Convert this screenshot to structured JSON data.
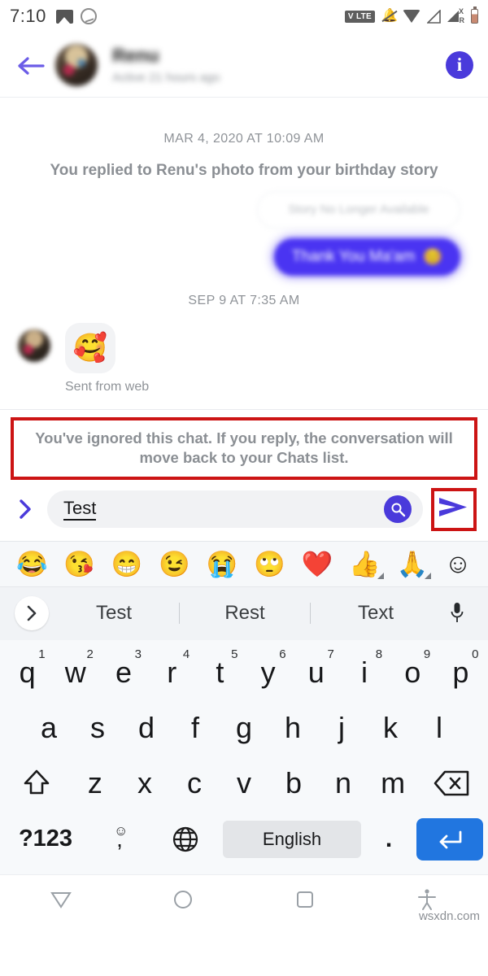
{
  "status_bar": {
    "time": "7:10",
    "left_icons": [
      "gallery-icon",
      "messenger-icon"
    ],
    "right_icons": [
      "volte-icon",
      "mute-bell-icon",
      "wifi-icon",
      "signal-icon",
      "signal-roaming-icon",
      "battery-icon"
    ],
    "volte_label": "V LTE",
    "signal_x_label": "X",
    "signal_r_label": "R"
  },
  "header": {
    "back_icon": "back-arrow-icon",
    "contact_name": "Renu",
    "contact_subtitle": "Active 21 hours ago",
    "info_label": "i",
    "info_color": "#4a3adb"
  },
  "conversation": {
    "timestamp_1": "MAR 4, 2020 AT 10:09 AM",
    "system_line": "You replied to Renu's photo from your birthday story",
    "story_unavailable": "Story No Longer Available",
    "sent_bubble_text": "Thank You Ma'am",
    "sent_bubble_emoji": "😊",
    "sent_bubble_color": "#4a34f2",
    "timestamp_2": "SEP 9 AT 7:35 AM",
    "sticker_emoji": "🥰",
    "sent_from_label": "Sent from web"
  },
  "ignored_notice": {
    "text": "You've ignored this chat. If you reply, the conversation will move back to your Chats list.",
    "highlight_color": "#cc1414"
  },
  "composer": {
    "expand_icon": "chevron-right-icon",
    "input_value": "Test",
    "search_icon": "search-icon",
    "search_bg_color": "#4a3adb",
    "send_icon": "send-arrow-icon",
    "send_color": "#4a3adb",
    "send_highlight_color": "#cc1414"
  },
  "emoji_bar": {
    "items": [
      {
        "glyph": "😂",
        "name": "face-with-tears-of-joy"
      },
      {
        "glyph": "😘",
        "name": "face-blowing-a-kiss"
      },
      {
        "glyph": "😁",
        "name": "beaming-face"
      },
      {
        "glyph": "😉",
        "name": "winking-face"
      },
      {
        "glyph": "😭",
        "name": "loudly-crying-face"
      },
      {
        "glyph": "🙄",
        "name": "face-with-rolling-eyes"
      },
      {
        "glyph": "❤️",
        "name": "red-heart"
      },
      {
        "glyph": "👍",
        "name": "thumbs-up"
      },
      {
        "glyph": "🙏",
        "name": "folded-hands"
      },
      {
        "glyph": "☺",
        "name": "emoji-picker"
      }
    ]
  },
  "suggestions": {
    "expand_icon": "chevron-right-icon",
    "words": [
      "Test",
      "Rest",
      "Text"
    ],
    "mic_icon": "microphone-icon"
  },
  "keyboard": {
    "row1": [
      {
        "key": "q",
        "num": "1"
      },
      {
        "key": "w",
        "num": "2"
      },
      {
        "key": "e",
        "num": "3"
      },
      {
        "key": "r",
        "num": "4"
      },
      {
        "key": "t",
        "num": "5"
      },
      {
        "key": "y",
        "num": "6"
      },
      {
        "key": "u",
        "num": "7"
      },
      {
        "key": "i",
        "num": "8"
      },
      {
        "key": "o",
        "num": "9"
      },
      {
        "key": "p",
        "num": "0"
      }
    ],
    "row2": [
      "a",
      "s",
      "d",
      "f",
      "g",
      "h",
      "j",
      "k",
      "l"
    ],
    "row3": [
      "z",
      "x",
      "c",
      "v",
      "b",
      "n",
      "m"
    ],
    "shift_icon": "shift-icon",
    "backspace_icon": "backspace-icon",
    "symbols_label": "?123",
    "comma_label": ",",
    "comma_emoji": "☺",
    "globe_icon": "globe-icon",
    "space_label": "English",
    "period_label": ".",
    "enter_icon": "enter-icon",
    "enter_color": "#2176e0"
  },
  "navbar": {
    "back_icon": "nav-back-triangle-icon",
    "home_icon": "nav-home-circle-icon",
    "recents_icon": "nav-recents-square-icon",
    "accessibility_icon": "nav-accessibility-icon",
    "watermark": "wsxdn.com"
  }
}
